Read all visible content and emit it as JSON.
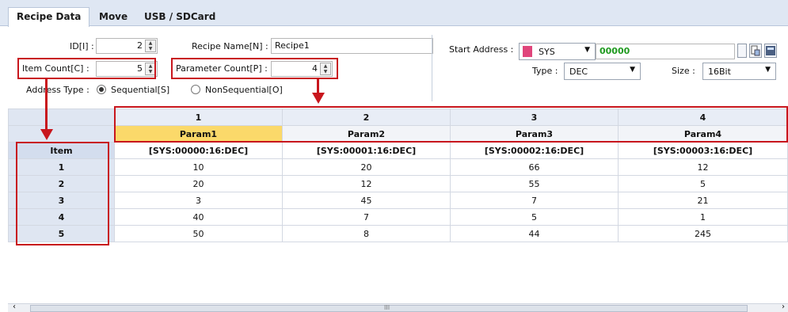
{
  "tabs": [
    {
      "label": "Recipe Data",
      "active": true
    },
    {
      "label": "Move",
      "active": false
    },
    {
      "label": "USB / SDCard",
      "active": false
    }
  ],
  "form": {
    "id_label": "ID[I] :",
    "id_value": "2",
    "recipe_name_label": "Recipe Name[N] :",
    "recipe_name_value": "Recipe1",
    "item_count_label": "Item Count[C] :",
    "item_count_value": "5",
    "param_count_label": "Parameter Count[P] :",
    "param_count_value": "4",
    "address_type_label": "Address Type :",
    "sequential_label": "Sequential[S]",
    "nonsequential_label": "NonSequential[O]",
    "sequential_selected": true
  },
  "address": {
    "start_label": "Start Address :",
    "device": "SYS",
    "address_value": "00000",
    "address_color": "#1f9a1f",
    "type_label": "Type :",
    "type_value": "DEC",
    "size_label": "Size :",
    "size_value": "16Bit"
  },
  "grid": {
    "col_numbers": [
      "1",
      "2",
      "3",
      "4"
    ],
    "param_names": [
      "Param1",
      "Param2",
      "Param3",
      "Param4"
    ],
    "addresses": [
      "[SYS:00000:16:DEC]",
      "[SYS:00001:16:DEC]",
      "[SYS:00002:16:DEC]",
      "[SYS:00003:16:DEC]"
    ],
    "item_header": "Item",
    "rows": [
      {
        "item": "1",
        "values": [
          "10",
          "20",
          "66",
          "12"
        ]
      },
      {
        "item": "2",
        "values": [
          "20",
          "12",
          "55",
          "5"
        ]
      },
      {
        "item": "3",
        "values": [
          "3",
          "45",
          "7",
          "21"
        ]
      },
      {
        "item": "4",
        "values": [
          "40",
          "7",
          "5",
          "1"
        ]
      },
      {
        "item": "5",
        "values": [
          "50",
          "8",
          "44",
          "245"
        ]
      }
    ]
  },
  "scrollbar": {
    "left_arrow": "‹",
    "right_arrow": "›",
    "grip": "III"
  },
  "colors": {
    "highlight": "#c8161d",
    "selected_header": "#fbd96a"
  }
}
